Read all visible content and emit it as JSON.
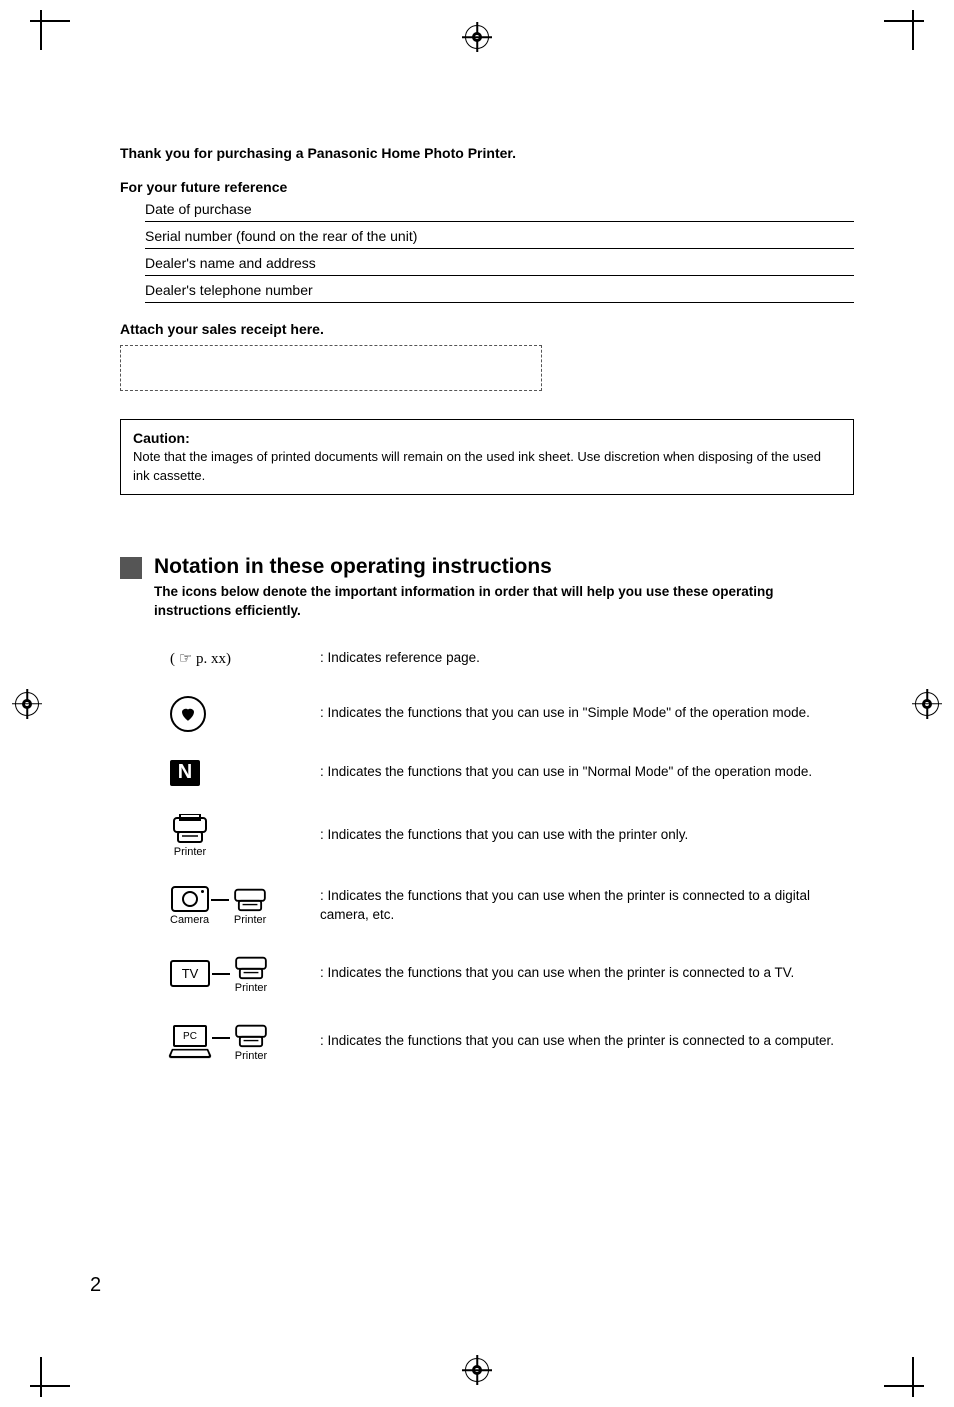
{
  "header": {
    "thank_you": "Thank you for purchasing a Panasonic Home Photo Printer.",
    "future_ref": "For your future reference",
    "rows": {
      "date": "Date of purchase",
      "serial": "Serial number (found on the rear of the unit)",
      "dealer_name": "Dealer's name and address",
      "dealer_phone": "Dealer's telephone number"
    },
    "attach_receipt": "Attach your sales receipt here."
  },
  "caution": {
    "title": "Caution:",
    "body": "Note that the images of printed documents will remain on the used ink sheet. Use discretion when disposing of the used ink cassette."
  },
  "notation": {
    "title": "Notation in these operating instructions",
    "sub": "The icons below denote the important information in order that will help you use these operating instructions efficiently."
  },
  "legend": {
    "ref_icon_text": "( ☞ p. xx)",
    "ref": ": Indicates reference page.",
    "heart": ": Indicates the functions that you can use in \"Simple Mode\" of the operation mode.",
    "n": ": Indicates the functions that you can use in \"Normal Mode\" of the operation mode.",
    "printer_only": ": Indicates the functions that you can use with the printer only.",
    "camera_printer": ": Indicates the functions that you can use when the printer is connected to a digital camera, etc.",
    "tv_printer": ": Indicates the functions that you can use when the printer is connected to a TV.",
    "pc_printer": ": Indicates the functions that you can use when the printer is connected to a computer."
  },
  "labels": {
    "printer": "Printer",
    "camera": "Camera",
    "tv": "TV",
    "pc": "PC",
    "n": "N"
  },
  "page_number": "2"
}
